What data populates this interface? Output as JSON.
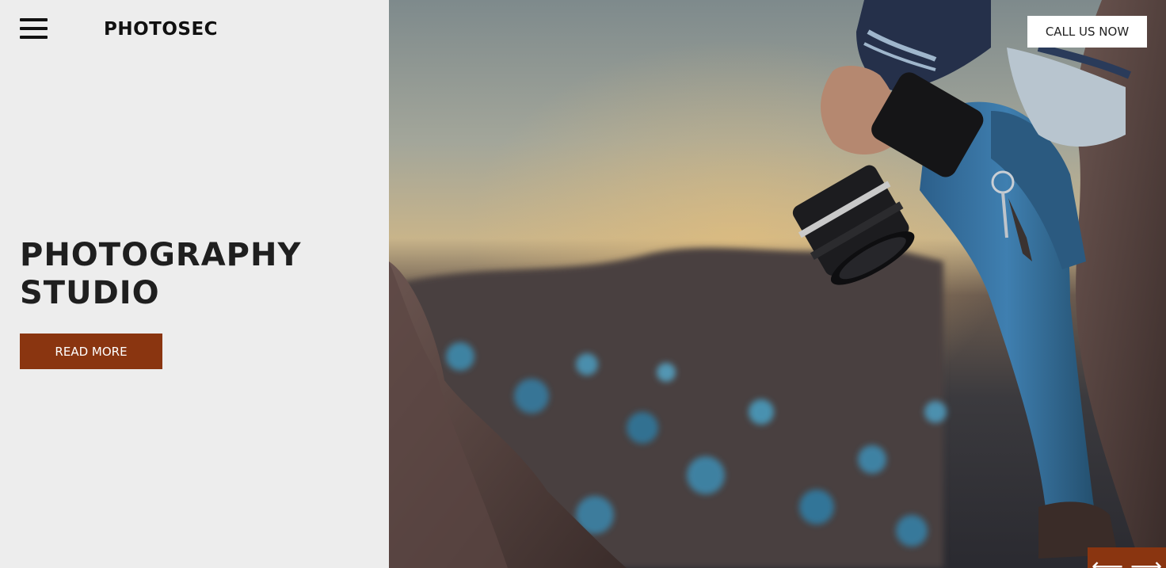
{
  "header": {
    "menu_icon": "hamburger-menu-icon",
    "brand": "PHOTOSEC",
    "cta_label": "CALL US NOW"
  },
  "hero": {
    "title_line1": "PHOTOGRAPHY",
    "title_line2": "STUDIO",
    "button_label": "READ MORE",
    "image_alt_icon": "photographer-with-camera-image"
  },
  "slider": {
    "prev_icon": "arrow-left-icon",
    "next_icon": "arrow-right-icon",
    "prev_glyph": "⟵",
    "next_glyph": "⟶"
  },
  "colors": {
    "accent": "#8a3510",
    "background": "#ededed",
    "text": "#1f1f1f"
  }
}
